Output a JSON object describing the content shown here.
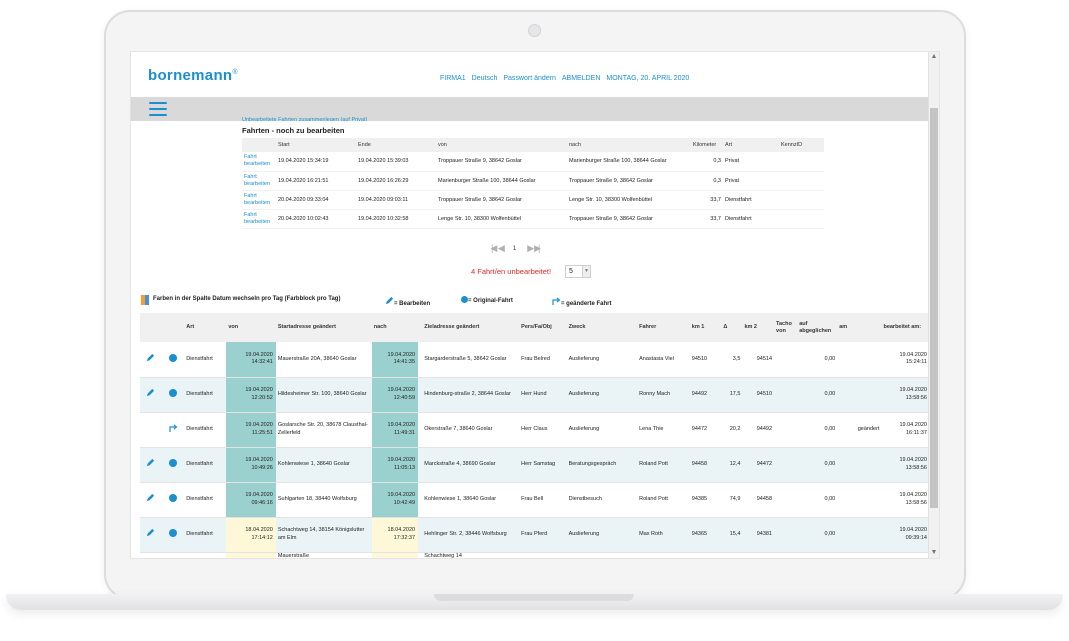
{
  "brand": {
    "name": "bornemann",
    "mark": "®"
  },
  "topnav": [
    "FIRMA1",
    "Deutsch",
    "Passwort ändern",
    "ABMELDEN",
    "MONTAG, 20. APRIL 2020"
  ],
  "header_link": "Unbearbeitete Fahrten zusammenlegen (auf Privat)",
  "section_title": "Fahrten - noch zu bearbeiten",
  "upper_table": {
    "columns": [
      "",
      "Start",
      "Ende",
      "von",
      "nach",
      "Kilometer",
      "Art",
      "KennzID"
    ],
    "edit_label_1": "Fahrt",
    "edit_label_2": "bearbeiten",
    "rows": [
      {
        "start": "19.04.2020 15:34:19",
        "ende": "19.04.2020 15:39:03",
        "von": "Troppauer Straße 9, 38642 Goslar",
        "nach": "Marienburger Straße 100, 38644 Goslar",
        "km": "0,3",
        "art": "Privat",
        "kenn": ""
      },
      {
        "start": "19.04.2020 16:21:51",
        "ende": "19.04.2020 16:26:29",
        "von": "Marienburger Straße 100, 38644 Goslar",
        "nach": "Troppauer Straße 9, 38642 Goslar",
        "km": "0,3",
        "art": "Privat",
        "kenn": ""
      },
      {
        "start": "20.04.2020 09:33:04",
        "ende": "19.04.2020 09:03:11",
        "von": "Troppauer Straße 9, 38642 Goslar",
        "nach": "Lenge Str. 10, 38300 Wolfenbüttel",
        "km": "33,7",
        "art": "Dienstfahrt",
        "kenn": ""
      },
      {
        "start": "20.04.2020 10:02:43",
        "ende": "19.04.2020 10:32:58",
        "von": "Lenge Str. 10, 38300 Wolfenbüttel",
        "nach": "Troppauer Straße 9, 38642 Goslar",
        "km": "33,7",
        "art": "Dienstfahrt",
        "kenn": ""
      }
    ]
  },
  "pager": {
    "first": "|◀",
    "prev": "◀",
    "page": "1",
    "next": "▶",
    "last": "▶|"
  },
  "unedited_text": "4 Fahrt/en unbearbeitet!",
  "page_size": "5",
  "legend": {
    "colors": "Farben in der Spalte Datum wechseln pro Tag (Farbblock pro Tag)",
    "edit": "= Bearbeiten",
    "original": "= Original-Fahrt",
    "changed": "= geänderte Fahrt"
  },
  "main_table": {
    "columns": [
      "",
      "",
      "Art",
      "von",
      "Startadresse geändert",
      "nach",
      "",
      "Zieladresse geändert",
      "Pers/Fa/Obj",
      "Zweck",
      "Fahrer",
      "km 1",
      "Δ",
      "km 2",
      "Tacho von",
      "auf abgeglichen",
      "am",
      "bearbeitet am:"
    ],
    "rows": [
      {
        "icon": "original",
        "art": "Dienstfahrt",
        "von_date": "19.04.2020",
        "von_time": "14:32:41",
        "start_addr": "Mauerstraße 20A, 38640 Goslar",
        "nach_date": "19.04.2020",
        "nach_time": "14:41:35",
        "ziel_addr": "Stargarderstraße 5, 38642 Goslar",
        "pers": "Frau Belred",
        "zweck": "Auslieferung",
        "fahrer": "Anastasia Viel",
        "km1": "94510",
        "delta": "3,5",
        "km2": "94514",
        "tacho": "",
        "abgl": "0,00",
        "am": "",
        "bearb_date": "19.04.2020",
        "bearb_time": "15:24:11",
        "day": "teal"
      },
      {
        "icon": "original",
        "art": "Dienstfahrt",
        "von_date": "19.04.2020",
        "von_time": "12:20:52",
        "start_addr": "Hildesheimer Str. 100, 38640 Goslar",
        "nach_date": "19.04.2020",
        "nach_time": "12:40:59",
        "ziel_addr": "Hindenburg-straße 2, 38644 Goslar",
        "pers": "Herr Hund",
        "zweck": "Auslieferung",
        "fahrer": "Ronny Mach",
        "km1": "94492",
        "delta": "17,5",
        "km2": "94510",
        "tacho": "",
        "abgl": "0,00",
        "am": "",
        "bearb_date": "19.04.2020",
        "bearb_time": "13:58:56",
        "day": "teal"
      },
      {
        "icon": "changed",
        "art": "Dienstfahrt",
        "von_date": "19.04.2020",
        "von_time": "11:25:51",
        "start_addr": "Goslarsche Str. 20, 38678 Clausthal-Zellerfeld",
        "nach_date": "19.04.2020",
        "nach_time": "11:49:31",
        "ziel_addr": "Okerstraße 7, 38640 Goslar",
        "pers": "Herr Claus",
        "zweck": "Auslieferung",
        "fahrer": "Lena Thie",
        "km1": "94472",
        "delta": "20,2",
        "km2": "94492",
        "tacho": "",
        "abgl": "0,00",
        "am": "geändert",
        "bearb_date": "19.04.2020",
        "bearb_time": "16:11:37",
        "day": "teal"
      },
      {
        "icon": "original",
        "art": "Dienstfahrt",
        "von_date": "19.04.2020",
        "von_time": "10:49:26",
        "start_addr": "Kohlenwiese 1, 38640 Goslar",
        "nach_date": "19.04.2020",
        "nach_time": "11:05:13",
        "ziel_addr": "Marckstraße 4, 38690 Goslar",
        "pers": "Herr Samstag",
        "zweck": "Beratungsgespräch",
        "fahrer": "Roland Pott",
        "km1": "94458",
        "delta": "12,4",
        "km2": "94472",
        "tacho": "",
        "abgl": "0,00",
        "am": "",
        "bearb_date": "19.04.2020",
        "bearb_time": "13:58:56",
        "day": "teal"
      },
      {
        "icon": "original",
        "art": "Dienstfahrt",
        "von_date": "19.04.2020",
        "von_time": "09:46:16",
        "start_addr": "Suhlgarten 18, 38440 Wolfsburg",
        "nach_date": "19.04.2020",
        "nach_time": "10:42:49",
        "ziel_addr": "Kohlenwiese 1, 38640 Goslar",
        "pers": "Frau Bell",
        "zweck": "Dienstbesuch",
        "fahrer": "Roland Pott",
        "km1": "94385",
        "delta": "74,9",
        "km2": "94458",
        "tacho": "",
        "abgl": "0,00",
        "am": "",
        "bearb_date": "19.04.2020",
        "bearb_time": "13:58:56",
        "day": "teal"
      },
      {
        "icon": "original",
        "art": "Dienstfahrt",
        "von_date": "18.04.2020",
        "von_time": "17:14:12",
        "start_addr": "Schachtweg 14, 38154 Königslutter am Elm",
        "nach_date": "18.04.2020",
        "nach_time": "17:32:37",
        "ziel_addr": "Hehlinger Str. 2, 38446 Wolfsburg",
        "pers": "Frau Pferd",
        "zweck": "Auslieferung",
        "fahrer": "Max Roth",
        "km1": "94365",
        "delta": "15,4",
        "km2": "94381",
        "tacho": "",
        "abgl": "0,00",
        "am": "",
        "bearb_date": "19.04.2020",
        "bearb_time": "09:39:14",
        "day": "cream"
      },
      {
        "icon": "none",
        "art": "",
        "von_date": "",
        "von_time": "",
        "start_addr": "Mauerstraße",
        "nach_date": "",
        "nach_time": "",
        "ziel_addr": "Schachtweg 14",
        "pers": "",
        "zweck": "",
        "fahrer": "",
        "km1": "",
        "delta": "",
        "km2": "",
        "tacho": "",
        "abgl": "",
        "am": "",
        "bearb_date": "",
        "bearb_time": "",
        "day": "cream"
      }
    ]
  },
  "colors": {
    "accent": "#1b8fcf",
    "teal": "#9ad1ce",
    "cream": "#fff8d8",
    "alert": "#e02828"
  },
  "icons": {
    "edit": "pencil-icon",
    "original": "blue-dot-icon",
    "changed": "changed-arrow-icon",
    "menu": "hamburger-icon"
  }
}
